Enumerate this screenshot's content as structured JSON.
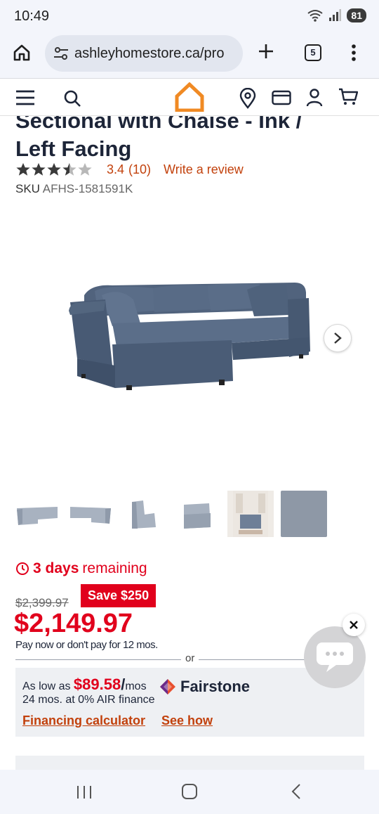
{
  "status": {
    "time": "10:49",
    "battery": "81"
  },
  "browser": {
    "url": "ashleyhomestore.ca/pro",
    "tab_count": "5"
  },
  "product": {
    "title_line1": "Sectional with Chaise - Ink /",
    "title_line2": "Left Facing",
    "rating_value": 3.4,
    "rating_label": "3.4",
    "review_count": "(10)",
    "write_review": "Write a review",
    "sku_label": "SKU",
    "sku_value": "AFHS-1581591K",
    "thumbnails": [
      "sectional-left",
      "sectional-right",
      "armless-chair",
      "corner-chair",
      "room-scene",
      "fabric-swatch"
    ]
  },
  "pricing": {
    "timer_count": "3 days",
    "timer_suffix": "remaining",
    "was_price": "$2,399.97",
    "save_badge": "Save $250",
    "price": "$2,149.97",
    "paynow": "Pay now or don't pay for 12 mos.",
    "or": "or"
  },
  "financing": {
    "as_low_as": "As low as",
    "amount": "$89.58",
    "slash": "/",
    "mos": "mos",
    "terms": "24 mos. at 0% AIR finance",
    "brand": "Fairstone",
    "calculator_link": "Financing calculator",
    "see_how_link": "See how"
  },
  "colors": {
    "accent": "#e1001c",
    "link": "#c2410c",
    "brand_orange": "#f08a24",
    "sofa": "#4a5d78"
  }
}
